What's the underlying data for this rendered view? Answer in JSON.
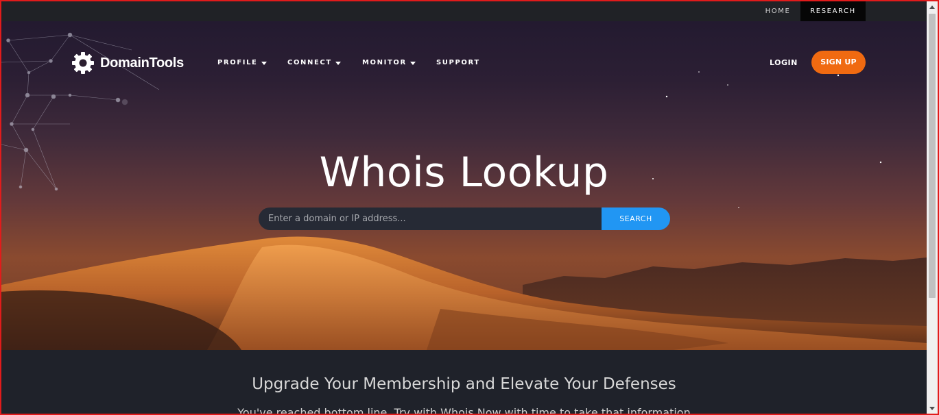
{
  "topbar": {
    "home_label": "HOME",
    "research_label": "RESEARCH"
  },
  "nav": {
    "brand": "DomainTools",
    "logo_icon": "gear-icon",
    "items": [
      {
        "label": "PROFILE",
        "has_dropdown": true
      },
      {
        "label": "CONNECT",
        "has_dropdown": true
      },
      {
        "label": "MONITOR",
        "has_dropdown": true
      },
      {
        "label": "SUPPORT",
        "has_dropdown": false
      }
    ],
    "login_label": "LOGIN",
    "signup_label": "SIGN UP"
  },
  "hero": {
    "title": "Whois Lookup",
    "search_placeholder": "Enter a domain or IP address...",
    "search_button": "SEARCH"
  },
  "lower": {
    "heading": "Upgrade Your Membership and Elevate Your Defenses",
    "subtext": "You've reached bottom line. Try with Whois Now with time to take that information"
  },
  "colors": {
    "signup_bg": "#f06a11",
    "search_button_bg": "#2196f3",
    "topbar_bg": "#202226",
    "lower_bg": "#1f222a"
  }
}
